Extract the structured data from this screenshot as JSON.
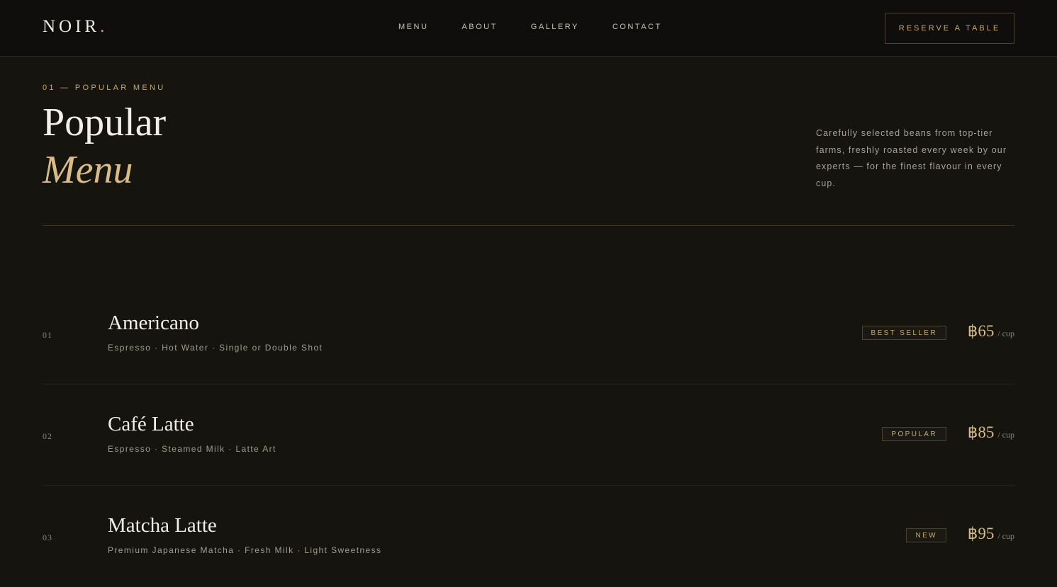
{
  "nav": {
    "logo": "NOIR",
    "logo_dot": ".",
    "links": [
      "MENU",
      "ABOUT",
      "GALLERY",
      "CONTACT"
    ],
    "cta": "RESERVE A TABLE"
  },
  "section": {
    "eyebrow": "01 — POPULAR MENU",
    "title_line1": "Popular",
    "title_line2": "Menu",
    "description": "Carefully selected beans from top-tier farms, freshly roasted every week by our experts — for the finest flavour in every cup."
  },
  "items": [
    {
      "num": "01",
      "name": "Americano",
      "desc": "Espresso · Hot Water · Single or Double Shot",
      "badge": "BEST SELLER",
      "price": "฿65",
      "unit": "/ cup"
    },
    {
      "num": "02",
      "name": "Café Latte",
      "desc": "Espresso · Steamed Milk · Latte Art",
      "badge": "POPULAR",
      "price": "฿85",
      "unit": "/ cup"
    },
    {
      "num": "03",
      "name": "Matcha Latte",
      "desc": "Premium Japanese Matcha · Fresh Milk · Light Sweetness",
      "badge": "NEW",
      "price": "฿95",
      "unit": "/ cup"
    }
  ],
  "colors": {
    "background": "#15140f",
    "accent_gold": "#c9a96a",
    "text": "#f3efe6"
  }
}
